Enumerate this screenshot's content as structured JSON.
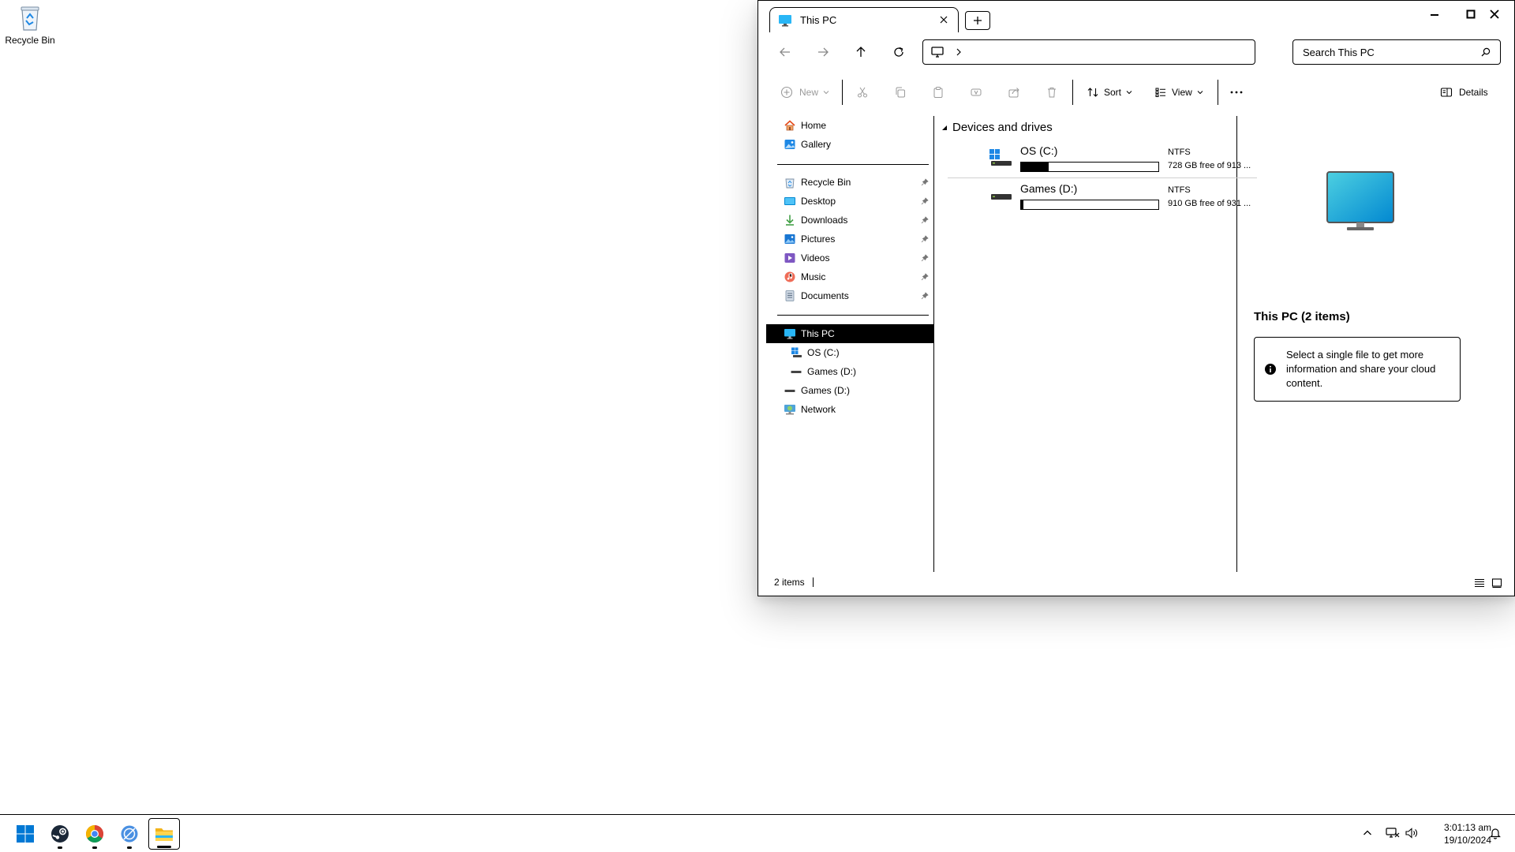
{
  "desktop": {
    "icons": [
      {
        "label": "Recycle Bin",
        "icon": "recycle-bin-icon"
      }
    ]
  },
  "window": {
    "tab": {
      "title": "This PC",
      "icon": "this-pc-icon"
    },
    "controls": [
      "minimize-icon",
      "maximize-icon",
      "close-icon"
    ],
    "search": {
      "placeholder": "Search This PC"
    },
    "toolbar": {
      "new_label": "New",
      "sort_label": "Sort",
      "view_label": "View",
      "details_label": "Details"
    },
    "nav": {
      "top": [
        {
          "label": "Home",
          "icon": "home-icon"
        },
        {
          "label": "Gallery",
          "icon": "gallery-icon"
        }
      ],
      "pinned": [
        {
          "label": "Recycle Bin",
          "icon": "recycle-bin-icon"
        },
        {
          "label": "Desktop",
          "icon": "desktop-folder-icon"
        },
        {
          "label": "Downloads",
          "icon": "downloads-icon"
        },
        {
          "label": "Pictures",
          "icon": "pictures-icon"
        },
        {
          "label": "Videos",
          "icon": "videos-icon"
        },
        {
          "label": "Music",
          "icon": "music-icon"
        },
        {
          "label": "Documents",
          "icon": "documents-icon"
        }
      ],
      "tree": [
        {
          "label": "This PC",
          "icon": "this-pc-icon",
          "selected": true
        },
        {
          "label": "OS (C:)",
          "icon": "windows-drive-icon"
        },
        {
          "label": "Games (D:)",
          "icon": "drive-icon"
        },
        {
          "label": "Games (D:)",
          "icon": "drive-icon"
        },
        {
          "label": "Network",
          "icon": "network-icon"
        }
      ]
    },
    "content": {
      "group_label": "Devices and drives",
      "drives": [
        {
          "name": "OS (C:)",
          "fs": "NTFS",
          "free_text": "728 GB free of 913 ...",
          "used_fraction": 0.2
        },
        {
          "name": "Games (D:)",
          "fs": "NTFS",
          "free_text": "910 GB free of 931 ...",
          "used_fraction": 0.02
        }
      ]
    },
    "details": {
      "title": "This PC (2 items)",
      "info": "Select a single file to get more information and share your cloud content."
    },
    "status": {
      "count": "2 items"
    }
  },
  "taskbar": {
    "apps": [
      "windows-start-icon",
      "steam-icon",
      "chrome-icon",
      "browser-icon",
      "file-explorer-icon"
    ],
    "time": "3:01:13 am",
    "date": "19/10/2024"
  }
}
